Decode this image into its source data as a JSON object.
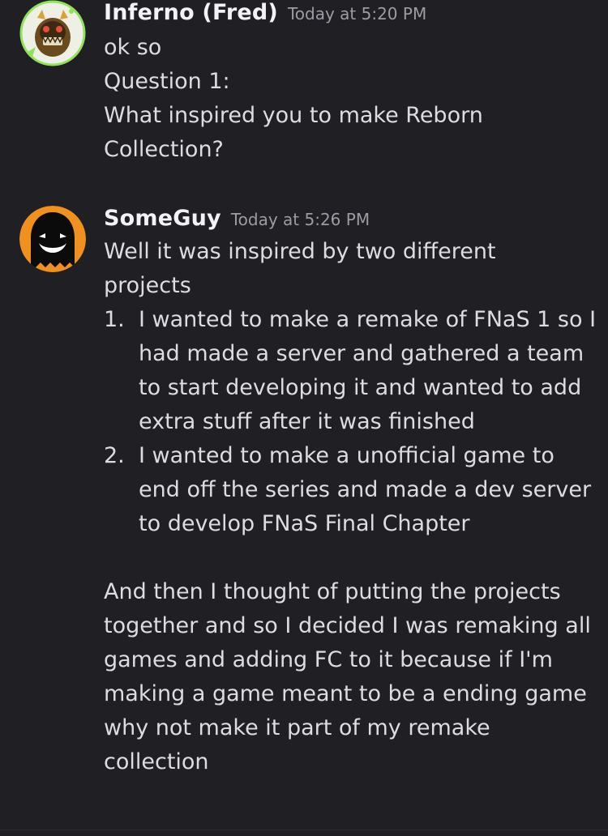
{
  "messages": [
    {
      "username": "Inferno (Fred)",
      "timestamp": "Today at 5:20 PM",
      "lines": [
        "ok so",
        "Question 1:",
        "What inspired you to make Reborn",
        "Collection?"
      ]
    },
    {
      "username": "SomeGuy",
      "timestamp": "Today at 5:26 PM",
      "intro_lines": [
        "Well it was inspired by two different",
        "projects"
      ],
      "list_items": [
        {
          "number": "1.",
          "lines": [
            "I wanted to make a remake of FNaS 1 so I",
            "had made a server and gathered a team",
            "to start developing it and wanted to add",
            "extra stuff after it was finished"
          ]
        },
        {
          "number": "2.",
          "lines": [
            "I wanted to make a unofficial game to",
            "end off the series and made a dev server",
            "to develop FNaS Final Chapter"
          ]
        }
      ],
      "outro_lines": [
        "And then I thought of putting the projects",
        "together and so I decided I was remaking all",
        "games and adding FC to it because if I'm",
        "making a game meant to be a ending game",
        "why not make it part of my remake",
        "collection"
      ]
    }
  ],
  "colors": {
    "background": "#1f1f24",
    "text": "#dcdde1",
    "username": "#f2f3f5",
    "timestamp": "#9b9ca4",
    "avatar_ring": "#8fe25a",
    "avatar2_bg": "#f0901e"
  },
  "icons": {
    "avatar1": "animatronic-avatar-icon",
    "avatar2": "black-ghost-avatar-icon"
  }
}
